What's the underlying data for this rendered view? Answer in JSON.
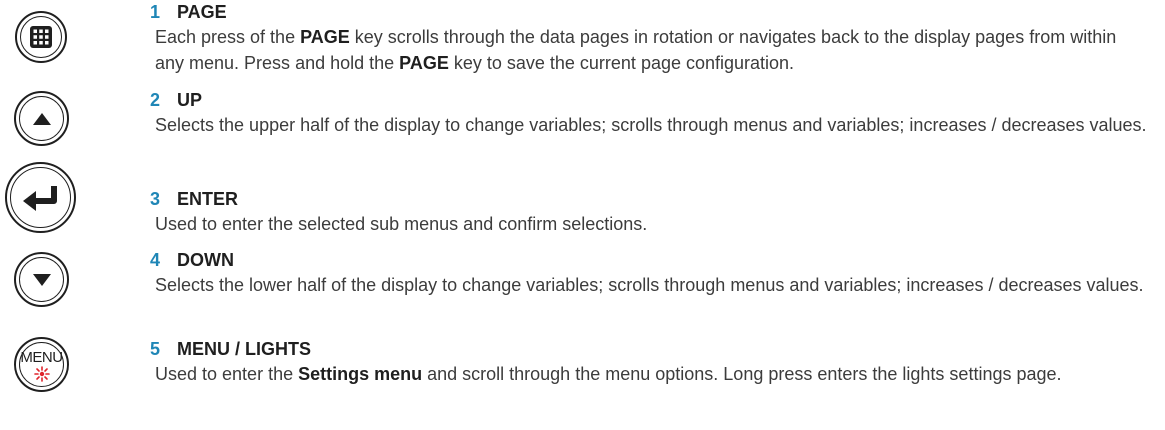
{
  "colors": {
    "number": "#1f86b6",
    "light_icon": "#e0242c",
    "key_outline": "#1f1f1f"
  },
  "keys": [
    {
      "icon": "grid-icon"
    },
    {
      "icon": "triangle-up-icon"
    },
    {
      "icon": "enter-arrow-icon"
    },
    {
      "icon": "triangle-down-icon"
    },
    {
      "icon": "sun-light-icon",
      "label": "MENU"
    }
  ],
  "items": [
    {
      "number": "1",
      "title": "PAGE",
      "segments": [
        "Each press of the ",
        "PAGE",
        " key scrolls through the data pages in rotation or navigates back to the display pages from within any menu. Press and hold the ",
        "PAGE",
        " key to save the current page configuration."
      ]
    },
    {
      "number": "2",
      "title": "UP",
      "description": "Selects the upper half of the display to change variables; scrolls through menus and variables; increases / decreases values."
    },
    {
      "number": "3",
      "title": "ENTER",
      "description": "Used to enter the selected sub menus and confirm selections."
    },
    {
      "number": "4",
      "title": "DOWN",
      "description": "Selects the lower half of the display to change variables; scrolls through menus and variables; increases / decreases values."
    },
    {
      "number": "5",
      "title": "MENU / LIGHTS",
      "segments": [
        "Used to enter the ",
        "Settings menu",
        " and scroll through the menu options. Long press enters the lights settings page."
      ]
    }
  ]
}
